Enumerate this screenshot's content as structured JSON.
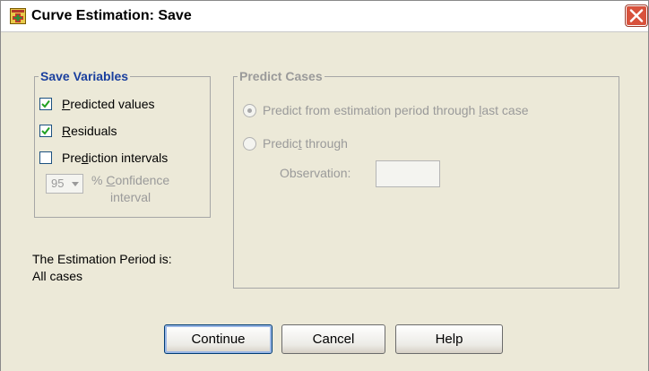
{
  "window": {
    "title": "Curve Estimation: Save",
    "icon": "spss-dialog-icon",
    "close_icon": "close-icon"
  },
  "save_variables": {
    "legend": "Save Variables",
    "predicted_values": {
      "pre": "",
      "mn": "P",
      "post": "redicted values",
      "checked": true
    },
    "residuals": {
      "pre": "",
      "mn": "R",
      "post": "esiduals",
      "checked": true
    },
    "prediction_intervals": {
      "pre": "Pre",
      "mn": "d",
      "post": "iction intervals",
      "checked": false
    },
    "confidence": {
      "value": "95",
      "label_pre": "% ",
      "label_mn": "C",
      "label_post": "onfidence",
      "label_line2": "interval"
    }
  },
  "estimation_period": {
    "label": "The Estimation Period is:",
    "value": "All cases"
  },
  "predict_cases": {
    "legend": "Predict Cases",
    "option1": {
      "pre": "Predict from estimation period through ",
      "mn": "l",
      "post": "ast case",
      "selected": true
    },
    "option2": {
      "pre": "Predic",
      "mn": "t",
      "post": " through",
      "selected": false
    },
    "observation_label": "Observation:",
    "observation_value": ""
  },
  "buttons": {
    "continue": "Continue",
    "cancel": "Cancel",
    "help": "Help"
  }
}
